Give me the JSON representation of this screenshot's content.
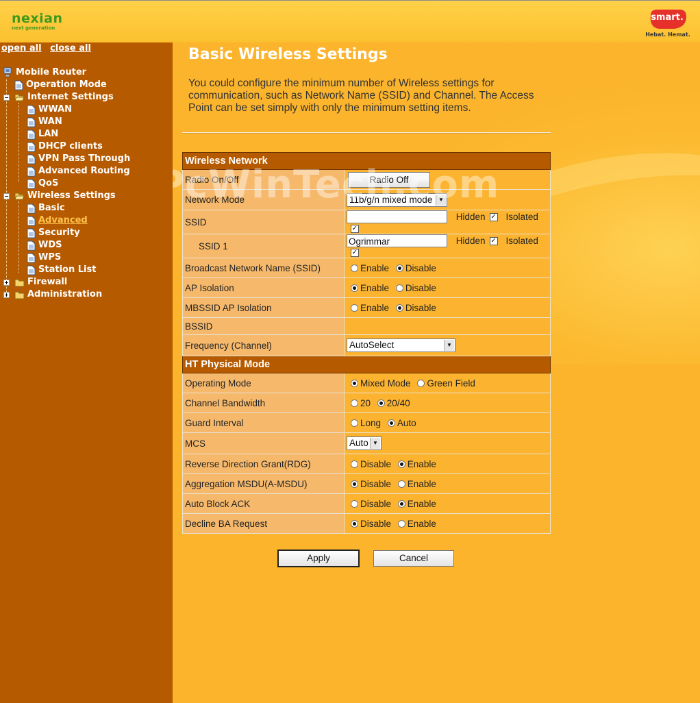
{
  "header": {
    "brand_name": "nexian",
    "brand_tagline": "next generation",
    "partner_name": "smart.",
    "partner_slogan": "Hebat. Hemat."
  },
  "sidebar": {
    "open_all": "open all",
    "close_all": "close all",
    "root": "Mobile Router",
    "items": {
      "operation_mode": "Operation Mode",
      "internet_settings": "Internet Settings",
      "wwan": "WWAN",
      "wan": "WAN",
      "lan": "LAN",
      "dhcp_clients": "DHCP clients",
      "vpn": "VPN Pass Through",
      "adv_routing": "Advanced Routing",
      "qos": "QoS",
      "wireless_settings": "Wireless Settings",
      "basic": "Basic",
      "advanced": "Advanced",
      "security": "Security",
      "wds": "WDS",
      "wps": "WPS",
      "station_list": "Station List",
      "firewall": "Firewall",
      "administration": "Administration"
    }
  },
  "page": {
    "title": "Basic Wireless Settings",
    "intro": "You could configure the minimum number of Wireless settings for communication, such as Network Name (SSID) and Channel. The Access Point can be set simply with only the minimum setting items.",
    "watermark": "PcWinTech.com"
  },
  "wireless": {
    "section": "Wireless Network",
    "radio_label": "Radio On/Off",
    "radio_button": "Radio Off",
    "mode_label": "Network Mode",
    "mode_value": "11b/g/n mixed mode",
    "ssid_label": "SSID",
    "ssid_value": "",
    "ssid1_label": "SSID 1",
    "ssid1_value": "Ogrimmar",
    "hidden": "Hidden",
    "isolated": "Isolated",
    "broadcast_label": "Broadcast Network Name (SSID)",
    "ap_iso_label": "AP Isolation",
    "mbssid_label": "MBSSID AP Isolation",
    "bssid_label": "BSSID",
    "freq_label": "Frequency (Channel)",
    "freq_value": "AutoSelect",
    "enable": "Enable",
    "disable": "Disable"
  },
  "ht": {
    "section": "HT Physical Mode",
    "op_mode_label": "Operating Mode",
    "mixed": "Mixed Mode",
    "green": "Green Field",
    "bw_label": "Channel Bandwidth",
    "bw_20": "20",
    "bw_2040": "20/40",
    "gi_label": "Guard Interval",
    "long": "Long",
    "auto": "Auto",
    "mcs_label": "MCS",
    "mcs_value": "Auto",
    "rdg_label": "Reverse Direction Grant(RDG)",
    "amsdu_label": "Aggregation MSDU(A-MSDU)",
    "aback_label": "Auto Block ACK",
    "decline_label": "Decline BA Request",
    "enable": "Enable",
    "disable": "Disable"
  },
  "actions": {
    "apply": "Apply",
    "cancel": "Cancel"
  },
  "colors": {
    "sidebar": "#b65a00",
    "background": "#fbb42c",
    "label_cell": "#f6b96c",
    "active_link": "#ffc24a"
  }
}
